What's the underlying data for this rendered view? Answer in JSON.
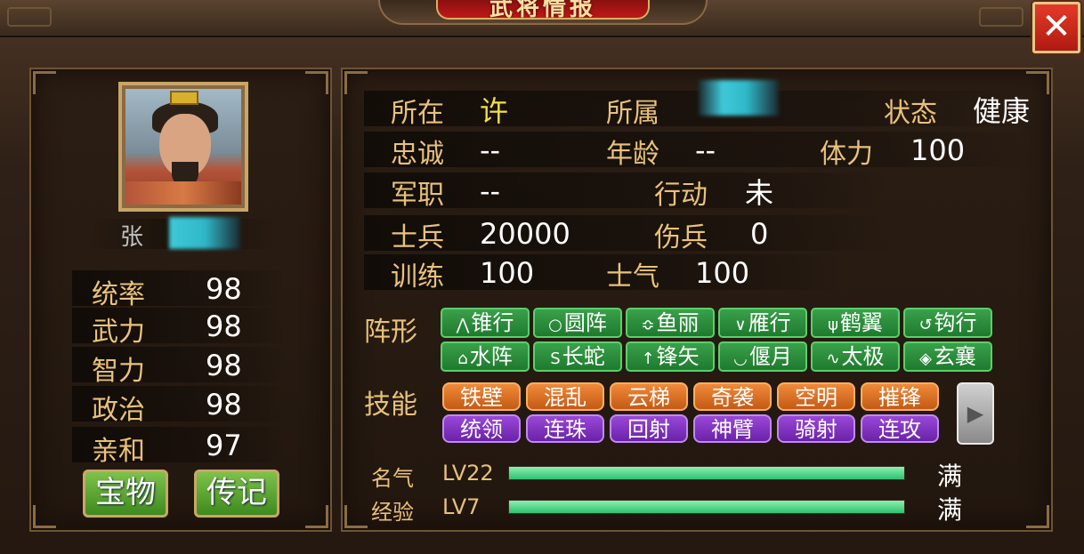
{
  "title": "武将情报",
  "close_label": "✕",
  "general": {
    "name": "张",
    "stats": [
      {
        "label": "统率",
        "value": "98"
      },
      {
        "label": "武力",
        "value": "98"
      },
      {
        "label": "智力",
        "value": "98"
      },
      {
        "label": "政治",
        "value": "98"
      },
      {
        "label": "亲和",
        "value": "97"
      }
    ],
    "buttons": {
      "treasure": "宝物",
      "biography": "传记"
    }
  },
  "info": {
    "location_label": "所在",
    "location_value": "许",
    "affiliation_label": "所属",
    "affiliation_value": "",
    "status_label": "状态",
    "status_value": "健康",
    "loyalty_label": "忠诚",
    "loyalty_value": "--",
    "age_label": "年龄",
    "age_value": "--",
    "stamina_label": "体力",
    "stamina_value": "100",
    "rank_label": "军职",
    "rank_value": "--",
    "action_label": "行动",
    "action_value": "未",
    "soldiers_label": "士兵",
    "soldiers_value": "20000",
    "wounded_label": "伤兵",
    "wounded_value": "0",
    "training_label": "训练",
    "training_value": "100",
    "morale_label": "士气",
    "morale_value": "100"
  },
  "formation": {
    "label": "阵形",
    "items": [
      {
        "icon": "⋀",
        "label": "锥行"
      },
      {
        "icon": "○",
        "label": "圆阵"
      },
      {
        "icon": "≎",
        "label": "鱼丽"
      },
      {
        "icon": "∨",
        "label": "雁行"
      },
      {
        "icon": "ψ",
        "label": "鹤翼"
      },
      {
        "icon": "↺",
        "label": "钩行"
      },
      {
        "icon": "⌂",
        "label": "水阵"
      },
      {
        "icon": "S",
        "label": "长蛇"
      },
      {
        "icon": "↑",
        "label": "锋矢"
      },
      {
        "icon": "◡",
        "label": "偃月"
      },
      {
        "icon": "∿",
        "label": "太极"
      },
      {
        "icon": "◈",
        "label": "玄襄"
      }
    ]
  },
  "skills": {
    "label": "技能",
    "row1": [
      "铁壁",
      "混乱",
      "云梯",
      "奇袭",
      "空明",
      "摧锋"
    ],
    "row2": [
      "统领",
      "连珠",
      "回射",
      "神臂",
      "骑射",
      "连攻"
    ],
    "next_icon": "▶"
  },
  "progress": {
    "fame": {
      "label": "名气",
      "level": "LV22",
      "status": "满",
      "percent": 100
    },
    "exp": {
      "label": "经验",
      "level": "LV7",
      "status": "满",
      "percent": 100
    }
  },
  "colors": {
    "label_gold": "#e8c27a",
    "formation_green": "#2a8a3a",
    "skill_orange": "#d86a22",
    "skill_purple": "#7a30b8",
    "bar_green": "#40d080"
  }
}
